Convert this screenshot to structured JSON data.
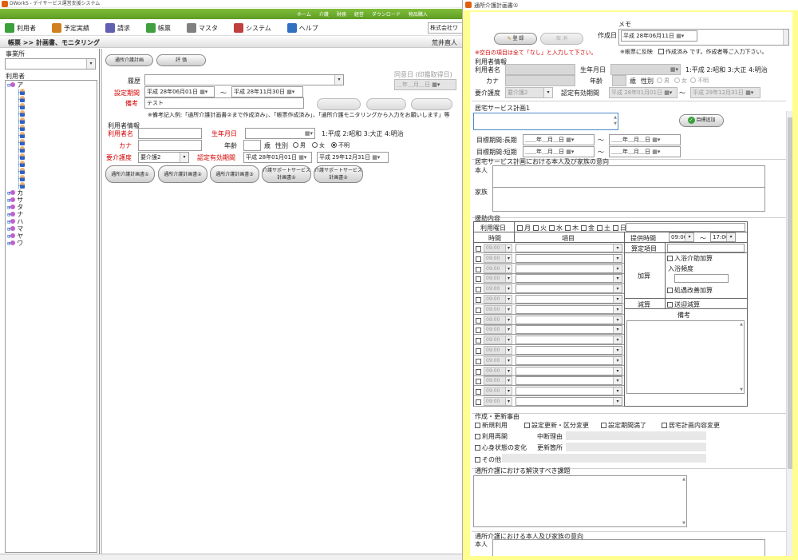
{
  "main": {
    "title": "DWorkS - デイサービス運営支援システム",
    "topnav": [
      "ホーム",
      "介護",
      "財務",
      "経営",
      "ダウンロード",
      "物品購入"
    ],
    "menu": [
      "利用者",
      "予定実績",
      "請求",
      "帳票",
      "マスタ",
      "システム",
      "ヘルプ"
    ],
    "company": "株式会社ワ",
    "breadcrumb": "帳票 >> 計画書、モニタリング",
    "staff": "荒井直人",
    "sidebar": {
      "office_label": "事業所",
      "user_label": "利用者",
      "groups": [
        "ア",
        "カ",
        "サ",
        "タ",
        "ナ",
        "ハ",
        "マ",
        "ヤ",
        "ワ"
      ],
      "a_count": 14
    },
    "tabs": [
      "通所介護計画",
      "評 価"
    ],
    "rireki": "履歴",
    "period_label": "設定期間",
    "period_from": "平成 28年06月01日",
    "period_to": "平成 28年11月30日",
    "wave": "〜",
    "biko_label": "備考",
    "biko_value": "テスト",
    "consent_label": "同意日 (印鑑取得日)",
    "consent_value": "＿年＿月＿日",
    "note": "※備考記入例:「通所介護計画書②まで作成済み」、「帳票作成済み」、「通所介護モニタリングから入力をお願いします」等",
    "user_info_label": "利用者情報",
    "name_label": "利用者名",
    "birth_label": "生年月日",
    "era_note": "1:平成 2:昭和 3:大正 4:明治",
    "kana_label": "カナ",
    "age_label": "年齢",
    "age_unit": "歳",
    "sex_label": "性別",
    "sex_options": [
      "男",
      "女",
      "不明"
    ],
    "kaigo_label": "要介護度",
    "kaigo_value": "要介護2",
    "valid_label": "認定有効期間",
    "valid_from": "平成 28年01月01日",
    "valid_to": "平成 29年12月31日",
    "btm_buttons": [
      "通所介護計画書①",
      "通所介護計画書②",
      "通所介護計画書③",
      "介護サポートサービス計画書①",
      "介護サポートサービス計画書②"
    ]
  },
  "dialog": {
    "title": "通所介護計画書①",
    "register": "登 録",
    "cancel": "取 消",
    "memo_label": "メモ",
    "sakusei_label": "作成日",
    "sakusei_value": "平成 28年06月11日",
    "hint_red": "※空白の項目は全て「なし」と入力して下さい。",
    "hint2": "※帳票に反映",
    "hint3": "作成済み です。作成者等ご入力下さい。",
    "user_info": "利用者情報",
    "name_label": "利用者名",
    "birth_label": "生年月日",
    "era_note": "1:平成 2:昭和 3:大正 4:明治",
    "kana_label": "カナ",
    "age_label": "年齢",
    "age_unit": "歳",
    "sex_label": "性別",
    "sex_options": [
      "男",
      "女",
      "不明"
    ],
    "kaigo_label": "要介護度",
    "kaigo_value": "要介護2",
    "valid_label": "認定有効期間",
    "valid_from": "平成 28年01月01日",
    "valid_to": "平成 29年12月31日",
    "plan_label": "居宅サービス計画1",
    "goal_add": "目標追加",
    "long_label": "目標期間:長期",
    "short_label": "目標期間:短期",
    "date_empty": "＿＿年＿月＿日",
    "wave": "〜",
    "intent_label": "居宅サービス計画における本人及び家族の意向",
    "honnin": "本人",
    "kazoku": "家族",
    "support_label": "援助内容",
    "youbi_label": "利用曜日",
    "youbi": [
      "月",
      "火",
      "水",
      "木",
      "金",
      "土",
      "日"
    ],
    "time_col": "時間",
    "item_col": "項目",
    "teikyo_label": "提供時間",
    "teikyo_from": "09:00",
    "teikyo_to": "17:00",
    "row_time": "09:00",
    "santei": "算定項目",
    "kasan": "加算",
    "kasan_items": [
      "入浴介助加算",
      "入浴頻度",
      "処遇改善加算"
    ],
    "gensan": "減算",
    "gensan_item": "送迎減算",
    "bikou": "備考",
    "reason_label": "作成・更新事由",
    "reasons": [
      "新規利用",
      "設定更新・区分変更",
      "設定期間満了",
      "居宅計画内容変更"
    ],
    "restart": "利用再開",
    "stop_reason": "中断理由",
    "change": "心身状態の変化",
    "change_place": "更新箇所",
    "other": "その他",
    "issue_label": "通所介護における解決すべき課題",
    "intent2_label": "通所介護における本人及び家族の意向",
    "honnin2": "本人"
  }
}
